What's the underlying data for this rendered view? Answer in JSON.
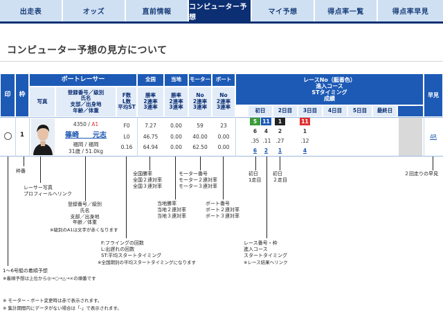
{
  "nav": {
    "tabs": [
      "出走表",
      "オッズ",
      "直前情報",
      "コンピューター予想",
      "マイ予想",
      "得点率一覧",
      "得点率早見"
    ],
    "active_index": 3
  },
  "page_title": "コンピューター予想の見方について",
  "header": {
    "col_mark": "印",
    "col_waku": "枠",
    "boat_racer": "ボートレーサー",
    "photo": "写真",
    "reg_info": "登録番号／級別\n氏名\n支部／出身地\n年齢／体重",
    "f_l_st": "F数\nL数\n平均ST",
    "zenkoku": "全国",
    "touchi": "当地",
    "motor": "モーター",
    "boat": "ボート",
    "rates_nat": "勝率\n2連率\n3連率",
    "rates_loc": "勝率\n2連率\n3連率",
    "rates_motor": "No\n2連率\n3連率",
    "rates_boat": "No\n2連率\n3連率",
    "race_info": "レースNo（艇番色）\n進入コース\nSTタイミング\n成績",
    "days": [
      "初日",
      "2日目",
      "3日目",
      "4日目",
      "5日目",
      "最終日"
    ],
    "hayami": "早見"
  },
  "row": {
    "waku": "1",
    "reg_no": "4350",
    "grade": "A1",
    "name": "篠崎　　元志",
    "branch": "福岡 / 福岡",
    "age_weight": "31歳 / 51.0kg",
    "f": "F0",
    "l": "L0",
    "st": "0.16",
    "nat": [
      "7.27",
      "46.75",
      "64.94"
    ],
    "loc": [
      "0.00",
      "0.00",
      "0.00"
    ],
    "motor": [
      "59",
      "40.00",
      "62.50"
    ],
    "boat": [
      "23",
      "0.00",
      "0.00"
    ],
    "races": [
      [
        "5",
        "11",
        "1",
        "11"
      ],
      [
        "6",
        "4",
        "2",
        "1"
      ],
      [
        ".35",
        ".11",
        ".27",
        ".12"
      ],
      [
        "6",
        "2",
        "1",
        "4"
      ]
    ],
    "hayami": "4R"
  },
  "annotations": {
    "waku": "枠番",
    "photo": "レーサー写真\nプロフィールヘリンク",
    "reg": "登録番号／級別\n氏名\n支部／出身地\n年齢／体重",
    "reg_note": "※級別のA1は文字が赤くなります",
    "fl": "F:フライングの回数\nL:出遅れの回数\nST:平均スタートタイミング",
    "fl_note": "※全国期別の平均スタートタイミングになります",
    "nat": "全国勝率\n全国２連対率\n全国３連対率",
    "loc": "当地勝率\n当地２連対率\n当地３連対率",
    "motor": "モーター番号\nモーター２連対率\nモーター３連対率",
    "boat": "ボート番号\nボート２連対率\nボート３連対率",
    "day1_r1": "初日\n1走目",
    "day1_r2": "初日\n２走目",
    "race": "レース番号・枠\n進入コース\nスタートタイミング",
    "race_note": "※レース結果ヘリンク",
    "hayami": "２回走りの早見",
    "mark": "1～6号艇の着順予想",
    "mark_note": "※着順予想は上位から◎→○→△→×の順番です",
    "foot1": "※ モーター・ボート変更時は赤で表示されます。",
    "foot2": "※ 集計期間内にデータがない場合は「-」で表示されます。"
  },
  "colors": {
    "nav_bg": "#cfe0f3",
    "nav_active": "#0c2f73",
    "header_blue": "#1d5ab5",
    "race_green": "#3a9a3a",
    "race_blue": "#1d5ab5",
    "race_black": "#222222",
    "race_red": "#e03030",
    "grade_red": "#e03030"
  }
}
